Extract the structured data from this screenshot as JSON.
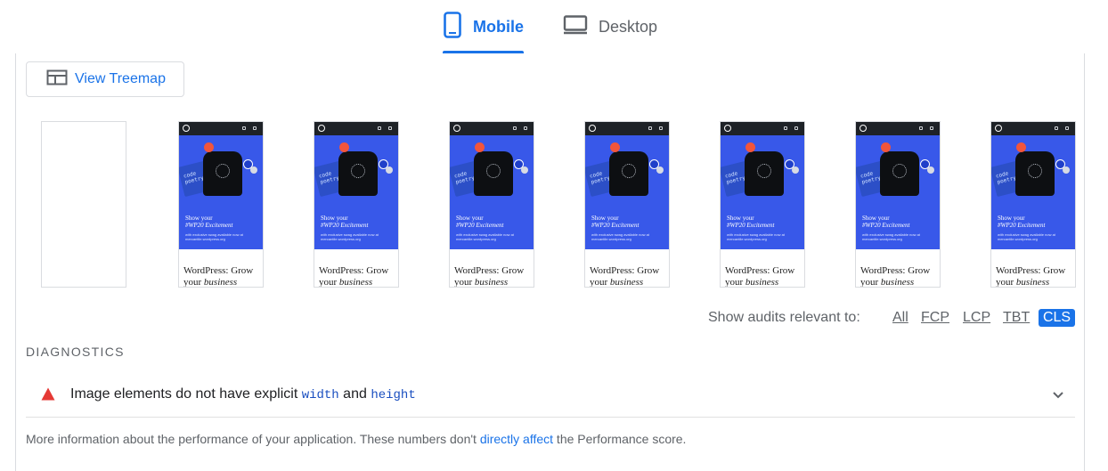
{
  "tabs": {
    "mobile": {
      "label": "Mobile",
      "icon": "smartphone-icon",
      "active": true
    },
    "desktop": {
      "label": "Desktop",
      "icon": "monitor-icon",
      "active": false
    }
  },
  "treemap_button": {
    "label": "View Treemap",
    "icon": "treemap-icon"
  },
  "filmstrip": {
    "frames": [
      {
        "blank": true
      },
      {
        "blank": false,
        "hero_title_line1": "Show your",
        "hero_title_line2": "#WP20 Excitement",
        "hero_sub": "with exclusive swag available now at mercantile.wordpress.org",
        "shirt_text": "code poetry",
        "body_line1": "WordPress: Grow",
        "body_line2_plain": "your ",
        "body_line2_italic": "business"
      }
    ],
    "repeat_count": 7,
    "colors": {
      "hero": "#3858e9",
      "header": "#1e2227"
    }
  },
  "audit_filter": {
    "label": "Show audits relevant to:",
    "options": [
      "All",
      "FCP",
      "LCP",
      "TBT",
      "CLS"
    ],
    "selected": "CLS"
  },
  "diagnostics": {
    "heading": "DIAGNOSTICS",
    "audits": [
      {
        "severity": "warning",
        "icon": "warning-triangle-icon",
        "title_prefix": "Image elements do not have explicit ",
        "code1": "width",
        "title_mid": " and ",
        "code2": "height",
        "expand_icon": "chevron-down-icon"
      }
    ],
    "footer_prefix": "More information about the performance of your application. These numbers don't ",
    "footer_link": "directly affect",
    "footer_suffix": " the Performance score."
  },
  "colors": {
    "accent": "#1a73e8",
    "warning": "#e53935",
    "muted_text": "#5f6368"
  }
}
